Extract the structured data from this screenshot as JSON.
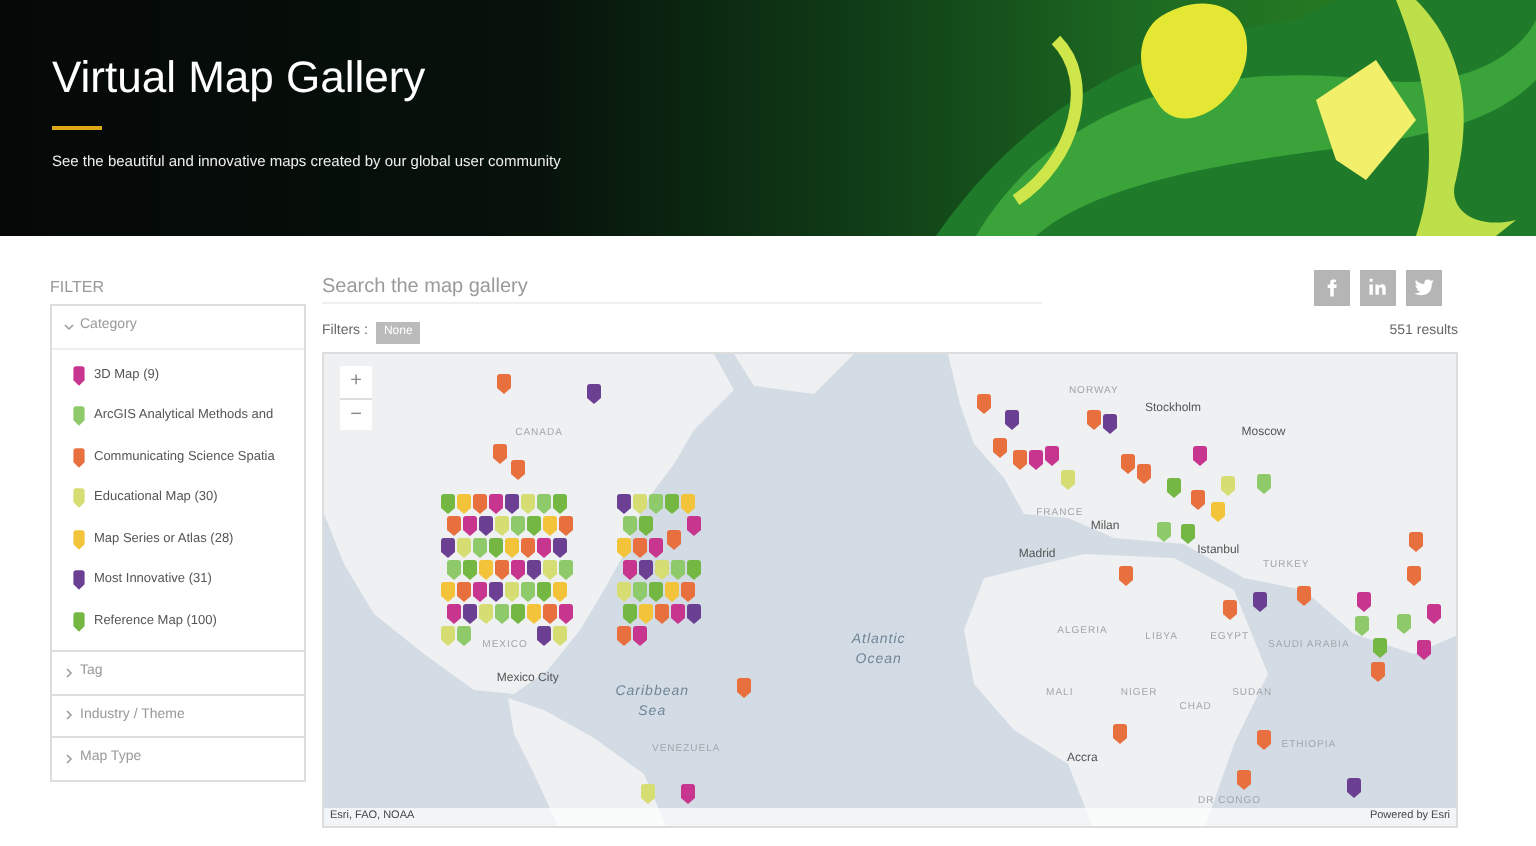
{
  "header": {
    "title": "Virtual Map Gallery",
    "subtitle": "See the beautiful and innovative maps created by our global user community"
  },
  "sidebar": {
    "heading": "FILTER",
    "groups": [
      {
        "label": "Category",
        "expanded": true,
        "items": [
          {
            "label": "3D Map (9)",
            "color": "#c8358f"
          },
          {
            "label": "ArcGIS Analytical Methods and",
            "color": "#8fca6a"
          },
          {
            "label": "Communicating Science Spatia",
            "color": "#e8703f"
          },
          {
            "label": "Educational Map (30)",
            "color": "#d6de73"
          },
          {
            "label": "Map Series or Atlas (28)",
            "color": "#f3c33a"
          },
          {
            "label": "Most Innovative (31)",
            "color": "#6b3f92"
          },
          {
            "label": "Reference Map (100)",
            "color": "#74b843"
          }
        ]
      },
      {
        "label": "Tag",
        "expanded": false
      },
      {
        "label": "Industry / Theme",
        "expanded": false
      },
      {
        "label": "Map Type",
        "expanded": false
      }
    ]
  },
  "search": {
    "placeholder": "Search the map gallery"
  },
  "filters": {
    "label": "Filters :",
    "tag": "None",
    "results": "551 results"
  },
  "map": {
    "zoom_in": "+",
    "zoom_out": "−",
    "labels": [
      {
        "text": "CANADA",
        "kind": "country"
      },
      {
        "text": "MEXICO",
        "kind": "country"
      },
      {
        "text": "Mexico City",
        "kind": "city"
      },
      {
        "text": "Caribbean Sea",
        "kind": "water"
      },
      {
        "text": "VENEZUELA",
        "kind": "country"
      },
      {
        "text": "Atlantic Ocean",
        "kind": "water"
      },
      {
        "text": "NORWAY",
        "kind": "country"
      },
      {
        "text": "Stockholm",
        "kind": "city"
      },
      {
        "text": "Moscow",
        "kind": "city"
      },
      {
        "text": "FRANCE",
        "kind": "country"
      },
      {
        "text": "Milan",
        "kind": "city"
      },
      {
        "text": "Madrid",
        "kind": "city"
      },
      {
        "text": "Istanbul",
        "kind": "city"
      },
      {
        "text": "TURKEY",
        "kind": "country"
      },
      {
        "text": "ALGERIA",
        "kind": "country"
      },
      {
        "text": "LIBYA",
        "kind": "country"
      },
      {
        "text": "EGYPT",
        "kind": "country"
      },
      {
        "text": "SAUDI ARABIA",
        "kind": "country"
      },
      {
        "text": "MALI",
        "kind": "country"
      },
      {
        "text": "NIGER",
        "kind": "country"
      },
      {
        "text": "CHAD",
        "kind": "country"
      },
      {
        "text": "SUDAN",
        "kind": "country"
      },
      {
        "text": "ETHIOPIA",
        "kind": "country"
      },
      {
        "text": "Accra",
        "kind": "city"
      },
      {
        "text": "DR CONGO",
        "kind": "country"
      }
    ],
    "attribution": "Esri, FAO, NOAA",
    "powered_by": "Powered by Esri"
  }
}
